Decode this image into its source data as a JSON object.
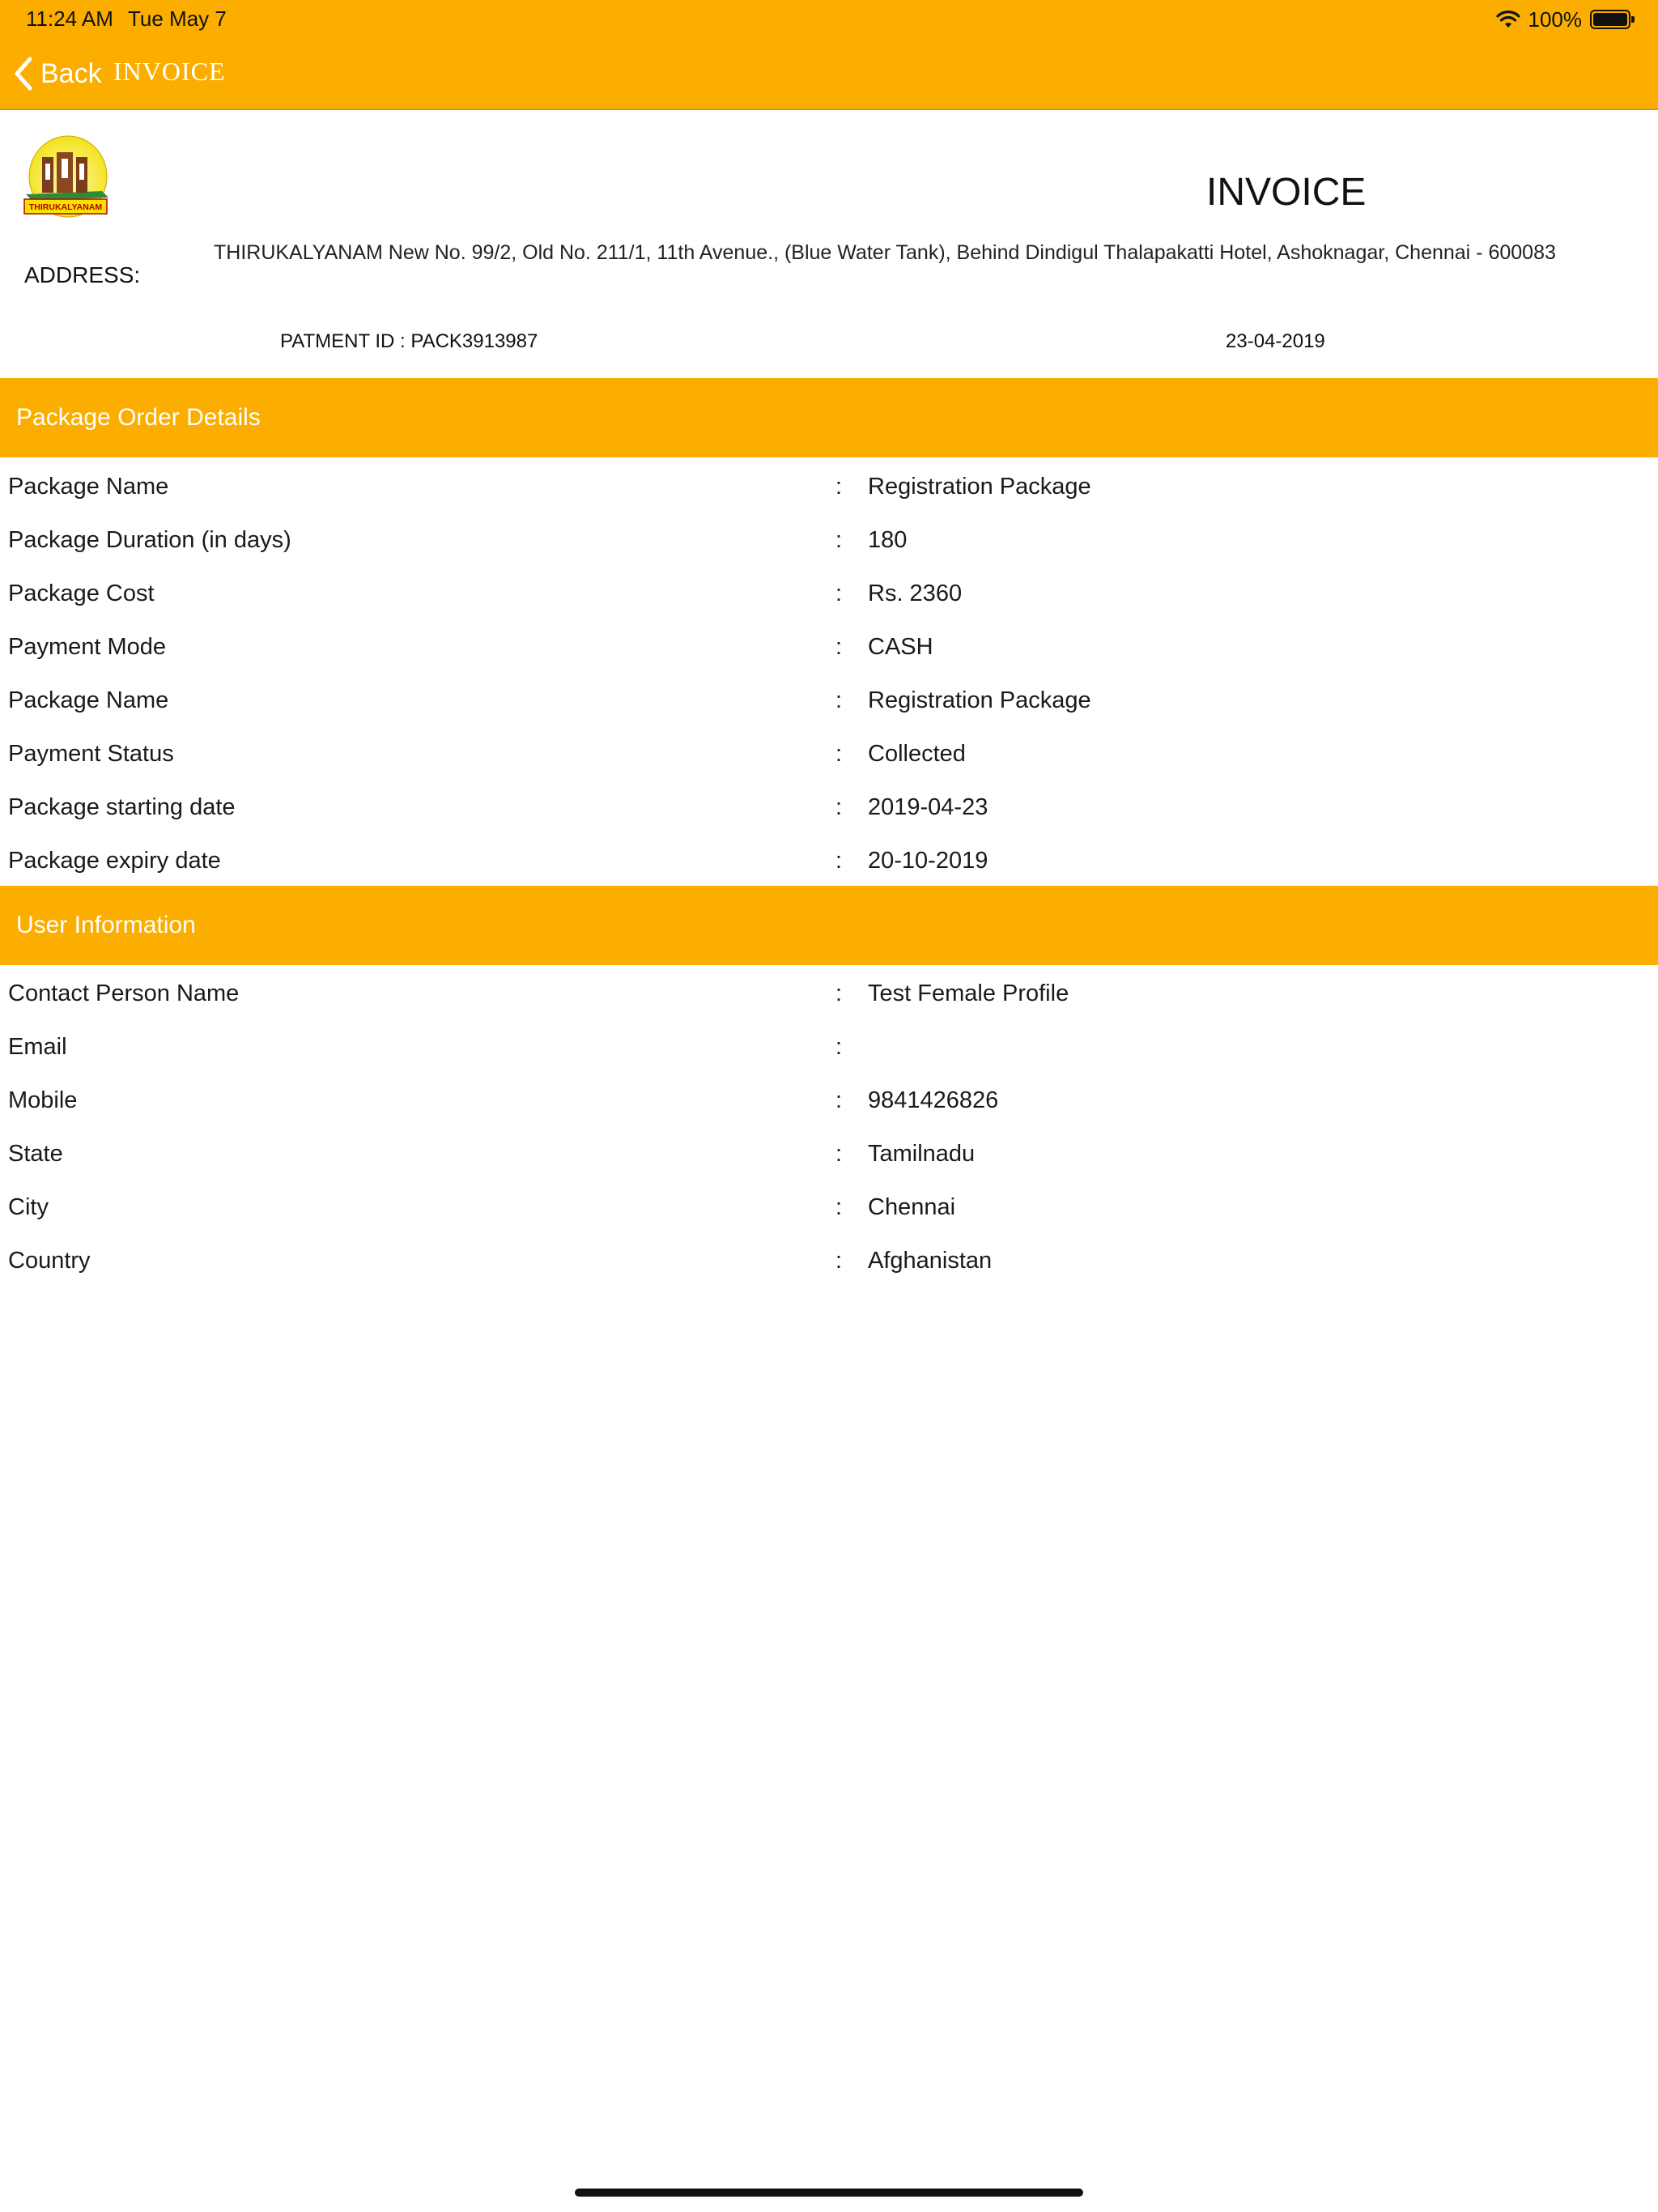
{
  "status_bar": {
    "time": "11:24 AM",
    "date": "Tue May 7",
    "battery_text": "100%",
    "battery_level": 1.0
  },
  "nav": {
    "back_label": "Back",
    "title": "INVOICE"
  },
  "header": {
    "logo_text": "THIRUKALYANAM",
    "heading": "INVOICE",
    "address_label": "ADDRESS:",
    "address": "THIRUKALYANAM New No. 99/2, Old No. 211/1, 11th Avenue., (Blue Water Tank), Behind Dindigul Thalapakatti Hotel,  Ashoknagar, Chennai - 600083",
    "payment_id": "PATMENT ID : PACK3913987",
    "payment_date": "23-04-2019"
  },
  "package_section": {
    "title": "Package Order Details",
    "rows": [
      {
        "label": "Package Name",
        "sep": ":",
        "value": "Registration Package"
      },
      {
        "label": "Package Duration (in days)",
        "sep": ":",
        "value": "180"
      },
      {
        "label": "Package Cost",
        "sep": ":",
        "value": "Rs. 2360"
      },
      {
        "label": "Payment Mode",
        "sep": ":",
        "value": "CASH"
      },
      {
        "label": "Package Name",
        "sep": ":",
        "value": "Registration Package"
      },
      {
        "label": "Payment Status",
        "sep": ":",
        "value": "Collected"
      },
      {
        "label": "Package starting date",
        "sep": ":",
        "value": "2019-04-23"
      },
      {
        "label": "Package expiry date",
        "sep": ":",
        "value": "20-10-2019"
      }
    ]
  },
  "user_section": {
    "title": "User Information",
    "rows": [
      {
        "label": "Contact Person Name",
        "sep": ":",
        "value": "Test Female Profile"
      },
      {
        "label": "Email",
        "sep": ":",
        "value": ""
      },
      {
        "label": "Mobile",
        "sep": ":",
        "value": "9841426826"
      },
      {
        "label": "State",
        "sep": ":",
        "value": "Tamilnadu"
      },
      {
        "label": "City",
        "sep": ":",
        "value": "Chennai"
      },
      {
        "label": "Country",
        "sep": ":",
        "value": "Afghanistan"
      }
    ]
  },
  "colors": {
    "accent": "#FBAE00",
    "header_text": "#FFFFFF",
    "body_text": "#1A1A1A"
  }
}
